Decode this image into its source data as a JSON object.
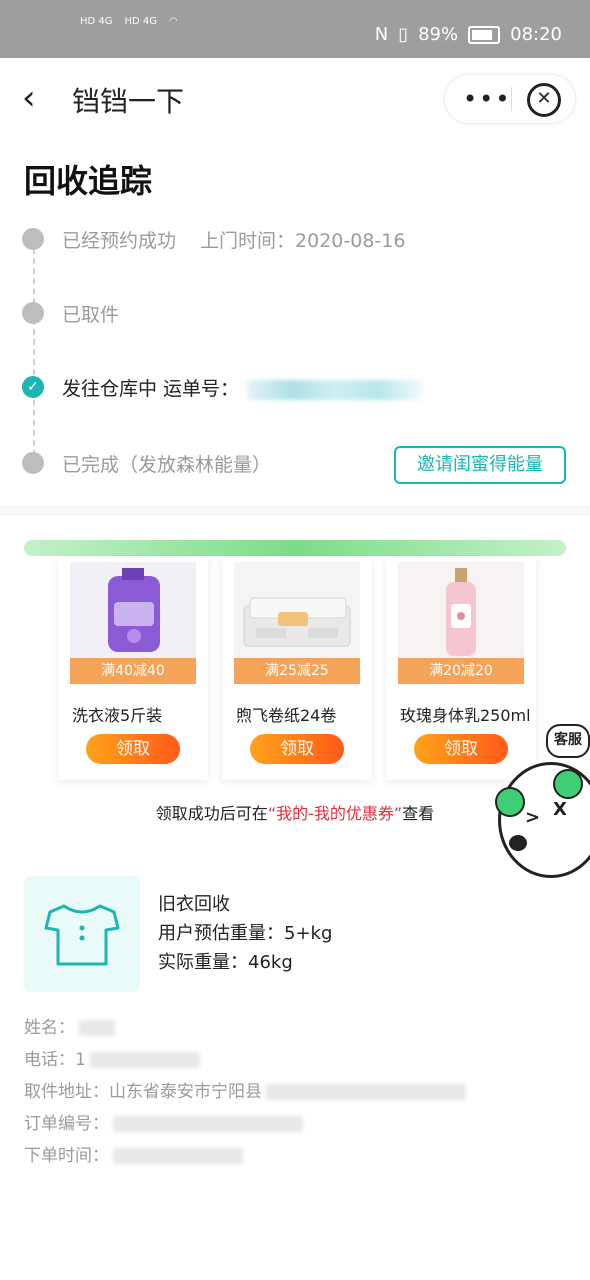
{
  "status_bar": {
    "signal_1": "HD 4G",
    "signal_2": "HD 4G",
    "battery_pct": "89%",
    "time": "08:20"
  },
  "nav": {
    "title": "铛铛一下",
    "more": "•••",
    "close": "✕"
  },
  "tracking": {
    "title": "回收追踪",
    "steps": [
      {
        "label": "已经预约成功",
        "extra": "上门时间：2020-08-16"
      },
      {
        "label": "已取件"
      },
      {
        "label": "发往仓库中 运单号：",
        "active": true
      },
      {
        "label": "已完成（发放森林能量）"
      }
    ],
    "invite_button": "邀请闺蜜得能量"
  },
  "coupons": {
    "items": [
      {
        "discount": "满40减40",
        "name": "洗衣液5斤装",
        "button": "领取"
      },
      {
        "discount": "满25减25",
        "name": "煦飞卷纸24卷",
        "button": "领取"
      },
      {
        "discount": "满20减20",
        "name": "玫瑰身体乳250ml",
        "button": "领取"
      }
    ],
    "tip_prefix": "领取成功后可在",
    "tip_highlight": "“我的-我的优惠券”",
    "tip_suffix": "查看"
  },
  "customer_service": {
    "label": "客服"
  },
  "item": {
    "name": "旧衣回收",
    "estimate": "用户预估重量：5+kg",
    "actual": "实际重量：46kg"
  },
  "details": {
    "name_label": "姓名：",
    "phone_label": "电话：",
    "phone_prefix": "1",
    "address_label": "取件地址：",
    "address_value": "山东省泰安市宁阳县",
    "order_label": "订单编号：",
    "time_label": "下单时间："
  },
  "colors": {
    "accent": "#1cb5b0",
    "coupon_orange": "#f6a35a",
    "highlight_red": "#e0303c"
  }
}
